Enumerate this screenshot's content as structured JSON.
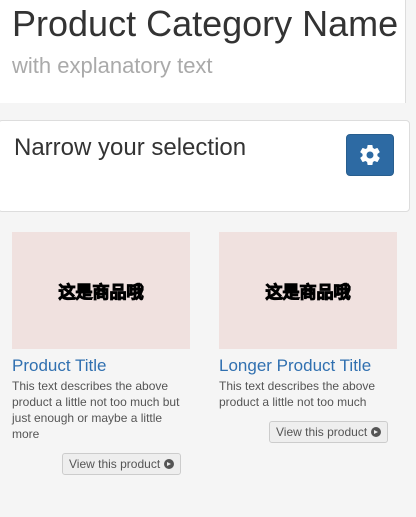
{
  "header": {
    "title": "Product Category Name",
    "subtitle": "with explanatory text"
  },
  "filter": {
    "title": "Narrow your selection",
    "button_icon": "gear-icon",
    "button_color": "#2d6aa3"
  },
  "products": [
    {
      "image_text": "这是商品哦",
      "title": "Product Title",
      "description": "This text describes the above product a little not too much but just enough or maybe a little more",
      "button_label": "View this product"
    },
    {
      "image_text": "这是商品哦",
      "title": "Longer Product Title",
      "description": "This text describes the above product a little not too much",
      "button_label": "View this product"
    }
  ],
  "colors": {
    "link": "#3070b0",
    "image_placeholder": "#f0e1df"
  }
}
